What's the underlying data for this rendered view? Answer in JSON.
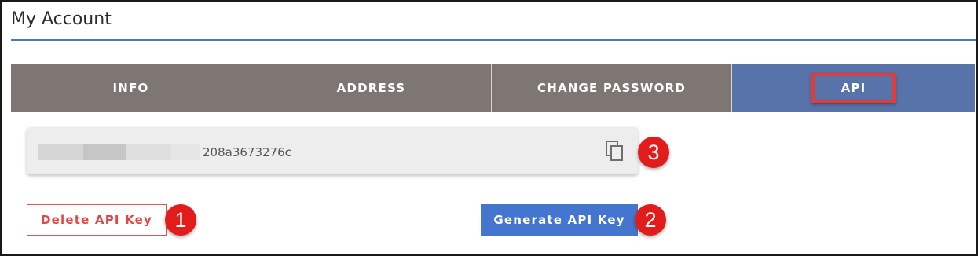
{
  "header": {
    "title": "My Account"
  },
  "tabs": [
    {
      "label": "INFO"
    },
    {
      "label": "ADDRESS"
    },
    {
      "label": "CHANGE PASSWORD"
    },
    {
      "label": "API",
      "active": true
    }
  ],
  "api": {
    "key_visible_suffix": "208a3673276c",
    "copy_icon": "copy-icon",
    "delete_label": "Delete API Key",
    "generate_label": "Generate API Key"
  },
  "callouts": {
    "one": "1",
    "two": "2",
    "three": "3"
  },
  "colors": {
    "accent": "#5873aa",
    "tab_bg": "#7d7673",
    "danger": "#e04848",
    "primary_button": "#4476cf",
    "callout": "#e21b1b"
  }
}
